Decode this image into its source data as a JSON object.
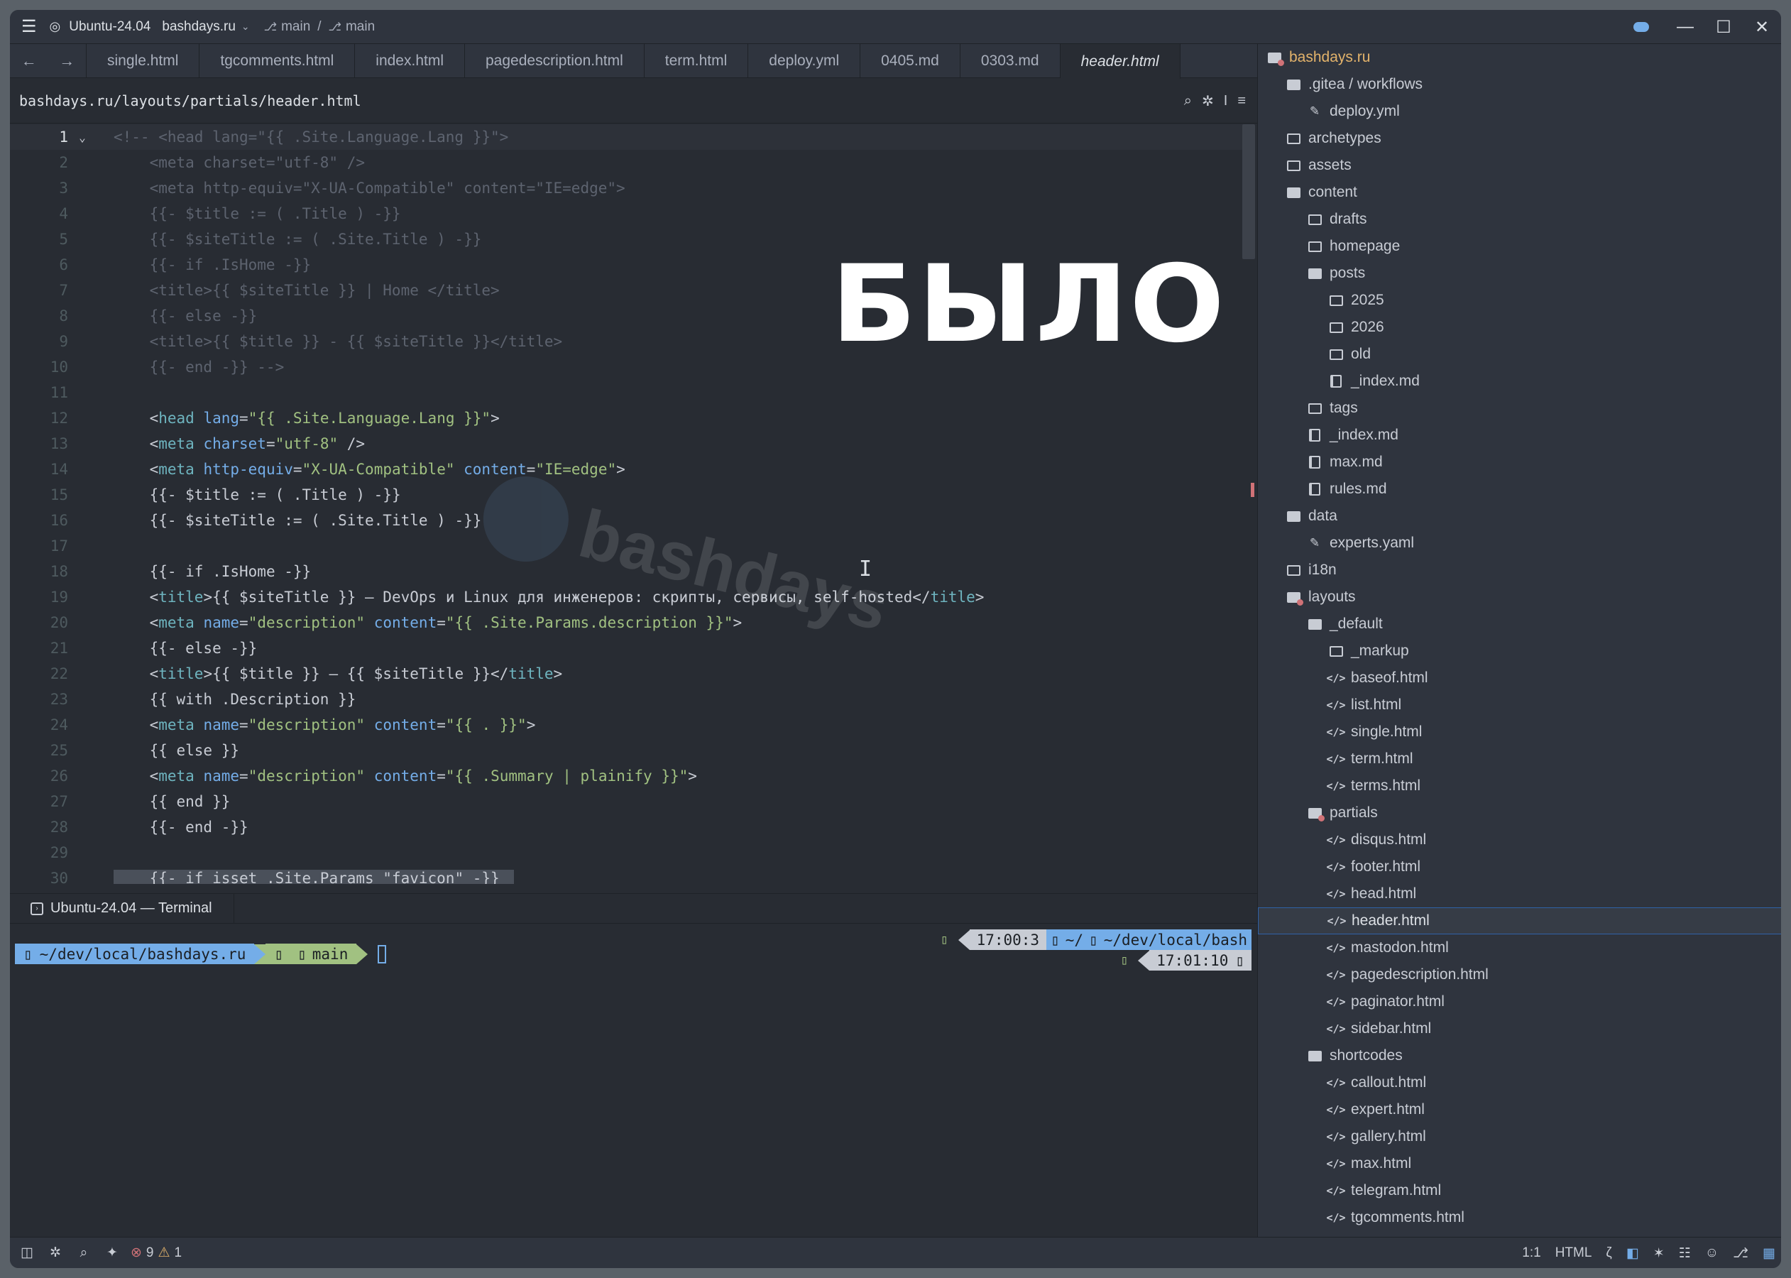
{
  "titlebar": {
    "project_env": "Ubuntu-24.04",
    "project_name": "bashdays.ru",
    "branch1": "main",
    "branch2": "main",
    "sep": "/"
  },
  "tabs": [
    {
      "label": "single.html"
    },
    {
      "label": "tgcomments.html"
    },
    {
      "label": "index.html"
    },
    {
      "label": "pagedescription.html"
    },
    {
      "label": "term.html"
    },
    {
      "label": "deploy.yml"
    },
    {
      "label": "0405.md"
    },
    {
      "label": "0303.md"
    },
    {
      "label": "header.html"
    }
  ],
  "breadcrumb": "bashdays.ru/layouts/partials/header.html",
  "overlay": {
    "big_label": "БЫЛО",
    "watermark": "bashdays"
  },
  "code_lines": [
    "1",
    "2",
    "3",
    "4",
    "5",
    "6",
    "7",
    "8",
    "9",
    "10",
    "11",
    "12",
    "13",
    "14",
    "15",
    "16",
    "17",
    "18",
    "19",
    "20",
    "21",
    "22",
    "23",
    "24",
    "25",
    "26",
    "27",
    "28",
    "29",
    "30"
  ],
  "code": {
    "l1": "<!-- <head lang=\"{{ .Site.Language.Lang }}\">",
    "l2": "    <meta charset=\"utf-8\" />",
    "l3": "    <meta http-equiv=\"X-UA-Compatible\" content=\"IE=edge\">",
    "l4": "    {{- $title := ( .Title ) -}}",
    "l5": "    {{- $siteTitle := ( .Site.Title ) -}}",
    "l6": "    {{- if .IsHome -}}",
    "l7": "    <title>{{ $siteTitle }} | Home </title>",
    "l8": "    {{- else -}}",
    "l9": "    <title>{{ $title }} - {{ $siteTitle }}</title>",
    "l10": "    {{- end -}} -->",
    "l15": "{{- $title := ( .Title ) -}}",
    "l16": "{{- $siteTitle := ( .Site.Title ) -}}",
    "l18": "{{- if .IsHome -}}",
    "l19_text": "{{ $siteTitle }} — DevOps и Linux для инженеров: скрипты, сервисы, self-hosted",
    "l21": "{{- else -}}",
    "l22_text": "{{ $title }} — {{ $siteTitle }}",
    "l23": "{{ with .Description }}",
    "l25": "{{ else }}",
    "l27": "{{ end }}",
    "l28": "{{- end -}}",
    "l30": "{{- if isset .Site.Params \"favicon\" -}}",
    "head_attr_val": "\"{{ .Site.Language.Lang }}\"",
    "charset_val": "\"utf-8\"",
    "http_equiv_val": "\"X-UA-Compatible\"",
    "content_edge_val": "\"IE=edge\"",
    "desc_val": "\"description\"",
    "site_desc_val": "\"{{ .Site.Params.description }}\"",
    "dot_val": "\"{{ . }}\"",
    "summary_val": "\"{{ .Summary | plainify }}\""
  },
  "terminal": {
    "tab_label": "Ubuntu-24.04 — Terminal",
    "path": "~/dev/local/bashdays.ru",
    "branch": "main",
    "time1": "17:00:3",
    "rpath": "~/",
    "rpath2": "~/dev/local/bash",
    "time2": "17:01:10"
  },
  "tree": [
    {
      "label": "bashdays.ru",
      "depth": 0,
      "icon": "folder-git"
    },
    {
      "label": ".gitea / workflows",
      "depth": 1,
      "icon": "folder-open"
    },
    {
      "label": "deploy.yml",
      "depth": 2,
      "icon": "yaml"
    },
    {
      "label": "archetypes",
      "depth": 1,
      "icon": "folder-closed"
    },
    {
      "label": "assets",
      "depth": 1,
      "icon": "folder-closed"
    },
    {
      "label": "content",
      "depth": 1,
      "icon": "folder-open"
    },
    {
      "label": "drafts",
      "depth": 2,
      "icon": "folder-closed"
    },
    {
      "label": "homepage",
      "depth": 2,
      "icon": "folder-closed"
    },
    {
      "label": "posts",
      "depth": 2,
      "icon": "folder-open"
    },
    {
      "label": "2025",
      "depth": 3,
      "icon": "folder-closed"
    },
    {
      "label": "2026",
      "depth": 3,
      "icon": "folder-closed"
    },
    {
      "label": "old",
      "depth": 3,
      "icon": "folder-closed"
    },
    {
      "label": "_index.md",
      "depth": 3,
      "icon": "book"
    },
    {
      "label": "tags",
      "depth": 2,
      "icon": "folder-closed"
    },
    {
      "label": "_index.md",
      "depth": 2,
      "icon": "book"
    },
    {
      "label": "max.md",
      "depth": 2,
      "icon": "book"
    },
    {
      "label": "rules.md",
      "depth": 2,
      "icon": "book"
    },
    {
      "label": "data",
      "depth": 1,
      "icon": "folder-open"
    },
    {
      "label": "experts.yaml",
      "depth": 2,
      "icon": "yaml"
    },
    {
      "label": "i18n",
      "depth": 1,
      "icon": "folder-closed"
    },
    {
      "label": "layouts",
      "depth": 1,
      "icon": "folder-git"
    },
    {
      "label": "_default",
      "depth": 2,
      "icon": "folder-open"
    },
    {
      "label": "_markup",
      "depth": 3,
      "icon": "folder-closed"
    },
    {
      "label": "baseof.html",
      "depth": 3,
      "icon": "code"
    },
    {
      "label": "list.html",
      "depth": 3,
      "icon": "code"
    },
    {
      "label": "single.html",
      "depth": 3,
      "icon": "code"
    },
    {
      "label": "term.html",
      "depth": 3,
      "icon": "code"
    },
    {
      "label": "terms.html",
      "depth": 3,
      "icon": "code"
    },
    {
      "label": "partials",
      "depth": 2,
      "icon": "folder-git"
    },
    {
      "label": "disqus.html",
      "depth": 3,
      "icon": "code"
    },
    {
      "label": "footer.html",
      "depth": 3,
      "icon": "code"
    },
    {
      "label": "head.html",
      "depth": 3,
      "icon": "code"
    },
    {
      "label": "header.html",
      "depth": 3,
      "icon": "code",
      "selected": true
    },
    {
      "label": "mastodon.html",
      "depth": 3,
      "icon": "code"
    },
    {
      "label": "pagedescription.html",
      "depth": 3,
      "icon": "code"
    },
    {
      "label": "paginator.html",
      "depth": 3,
      "icon": "code"
    },
    {
      "label": "sidebar.html",
      "depth": 3,
      "icon": "code"
    },
    {
      "label": "shortcodes",
      "depth": 2,
      "icon": "folder-open"
    },
    {
      "label": "callout.html",
      "depth": 3,
      "icon": "code"
    },
    {
      "label": "expert.html",
      "depth": 3,
      "icon": "code"
    },
    {
      "label": "gallery.html",
      "depth": 3,
      "icon": "code"
    },
    {
      "label": "max.html",
      "depth": 3,
      "icon": "code"
    },
    {
      "label": "telegram.html",
      "depth": 3,
      "icon": "code"
    },
    {
      "label": "tgcomments.html",
      "depth": 3,
      "icon": "code"
    }
  ],
  "statusbar": {
    "errors": "9",
    "warnings": "1",
    "cursor_pos": "1:1",
    "language": "HTML"
  },
  "colors": {
    "accent": "#74ade8",
    "string": "#a1c181",
    "tag": "#6eb4bf",
    "error": "#d07277",
    "warning": "#e3b36b"
  }
}
